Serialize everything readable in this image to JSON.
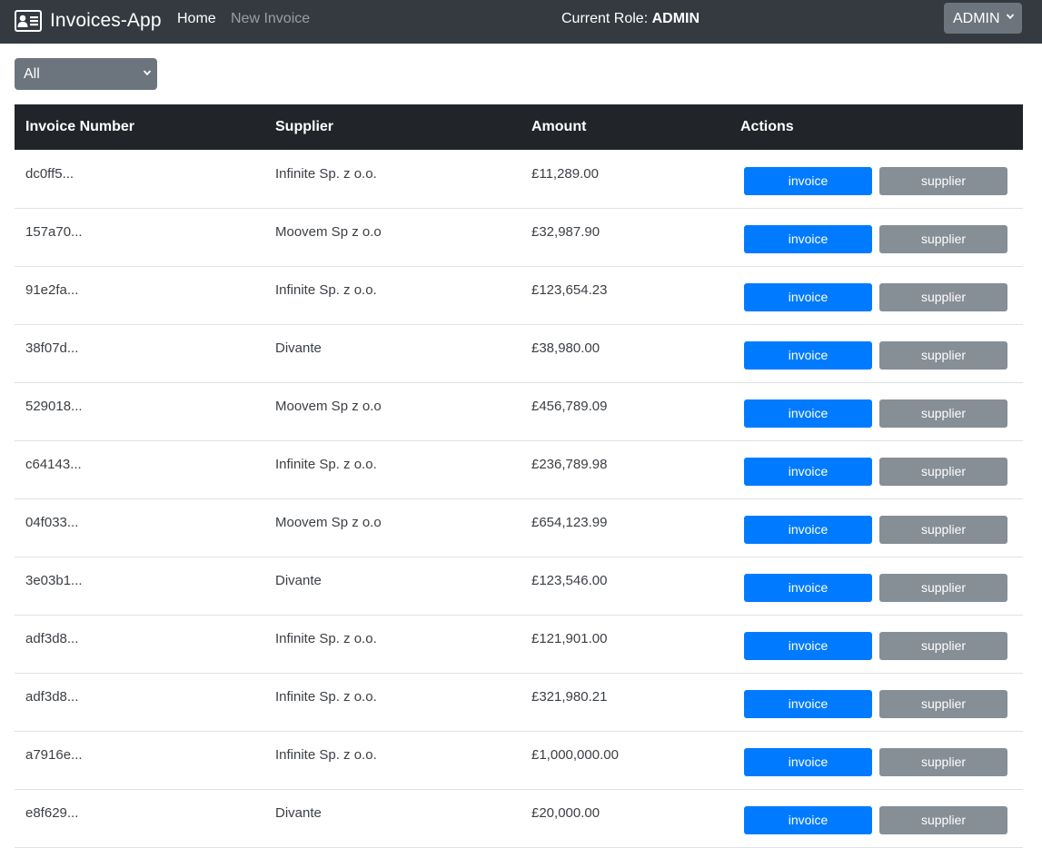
{
  "navbar": {
    "brand": "Invoices-App",
    "links": [
      {
        "label": "Home"
      },
      {
        "label": "New Invoice"
      }
    ],
    "role_prefix": "Current Role: ",
    "role_value": "ADMIN",
    "role_select_value": "ADMIN"
  },
  "filter": {
    "value": "All"
  },
  "table": {
    "columns": [
      "Invoice Number",
      "Supplier",
      "Amount",
      "Actions"
    ],
    "rows": [
      {
        "number": "dc0ff5...",
        "supplier": "Infinite Sp. z o.o.",
        "amount": "£11,289.00"
      },
      {
        "number": "157a70...",
        "supplier": "Moovem Sp z o.o",
        "amount": "£32,987.90"
      },
      {
        "number": "91e2fa...",
        "supplier": "Infinite Sp. z o.o.",
        "amount": "£123,654.23"
      },
      {
        "number": "38f07d...",
        "supplier": "Divante",
        "amount": "£38,980.00"
      },
      {
        "number": "529018...",
        "supplier": "Moovem Sp z o.o",
        "amount": "£456,789.09"
      },
      {
        "number": "c64143...",
        "supplier": "Infinite Sp. z o.o.",
        "amount": "£236,789.98"
      },
      {
        "number": "04f033...",
        "supplier": "Moovem Sp z o.o",
        "amount": "£654,123.99"
      },
      {
        "number": "3e03b1...",
        "supplier": "Divante",
        "amount": "£123,546.00"
      },
      {
        "number": "adf3d8...",
        "supplier": "Infinite Sp. z o.o.",
        "amount": "£121,901.00"
      },
      {
        "number": "adf3d8...",
        "supplier": "Infinite Sp. z o.o.",
        "amount": "£321,980.21"
      },
      {
        "number": "a7916e...",
        "supplier": "Infinite Sp. z o.o.",
        "amount": "£1,000,000.00"
      },
      {
        "number": "e8f629...",
        "supplier": "Divante",
        "amount": "£20,000.00"
      }
    ],
    "invoice_button_label": "invoice",
    "supplier_button_label": "supplier"
  },
  "icons": {
    "brand": "address-card-icon",
    "dropdown": "chevron-down-icon"
  },
  "colors": {
    "navbar": "#343a40",
    "table_header": "#212529",
    "primary": "#007bff",
    "secondary": "#6c757d",
    "supplier_button": "#868e96"
  }
}
